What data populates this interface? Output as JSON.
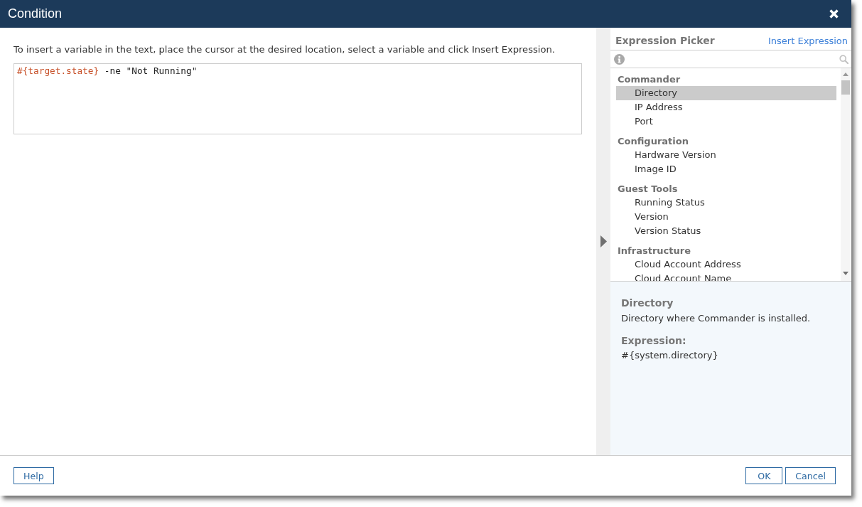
{
  "window": {
    "title": "Condition"
  },
  "instruction": "To insert a variable in the text, place the cursor at the desired location, select a variable and click Insert Expression.",
  "condition_editor": {
    "segments": [
      {
        "kind": "variable",
        "text": "#{target.state}"
      },
      {
        "kind": "plain",
        "text": " -ne \"Not Running\""
      }
    ]
  },
  "expression_picker": {
    "title": "Expression Picker",
    "insert_link": "Insert Expression",
    "tree": [
      {
        "label": "Commander",
        "children": [
          {
            "label": "Directory",
            "selected": true
          },
          {
            "label": "IP Address",
            "selected": false
          },
          {
            "label": "Port",
            "selected": false
          }
        ]
      },
      {
        "label": "Configuration",
        "children": [
          {
            "label": "Hardware Version",
            "selected": false
          },
          {
            "label": "Image ID",
            "selected": false
          }
        ]
      },
      {
        "label": "Guest Tools",
        "children": [
          {
            "label": "Running Status",
            "selected": false
          },
          {
            "label": "Version",
            "selected": false
          },
          {
            "label": "Version Status",
            "selected": false
          }
        ]
      },
      {
        "label": "Infrastructure",
        "children": [
          {
            "label": "Cloud Account Address",
            "selected": false
          },
          {
            "label": "Cloud Account Name",
            "selected": false
          }
        ]
      }
    ],
    "details": {
      "name": "Directory",
      "description": "Directory where Commander is installed.",
      "expression_label": "Expression:",
      "expression": "#{system.directory}"
    }
  },
  "footer": {
    "left_buttons": [
      {
        "label": "Help"
      }
    ],
    "right_buttons": [
      {
        "label": "OK"
      },
      {
        "label": "Cancel"
      }
    ]
  }
}
